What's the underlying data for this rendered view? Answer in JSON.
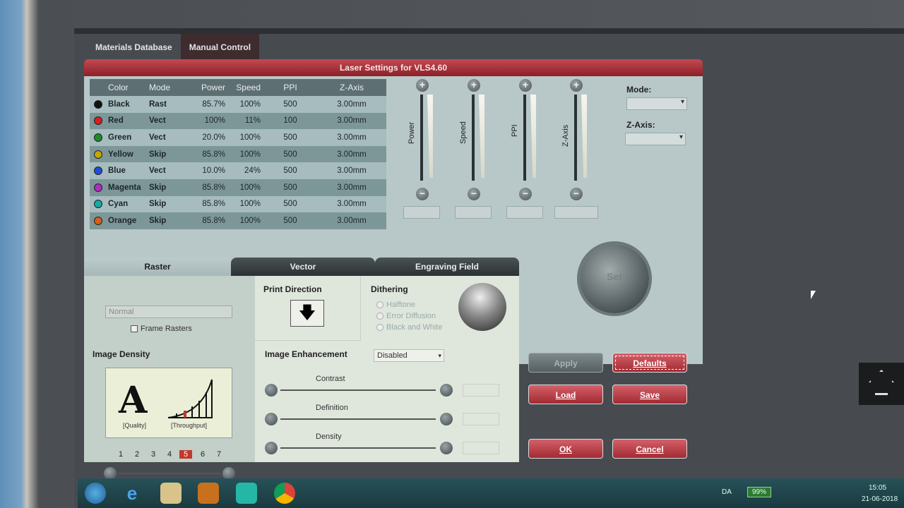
{
  "nav": {
    "tabs": [
      {
        "label": "Materials Database"
      },
      {
        "label": "Manual Control"
      }
    ]
  },
  "window": {
    "title": "Laser Settings for VLS4.60"
  },
  "table": {
    "headers": {
      "color": "Color",
      "mode": "Mode",
      "power": "Power",
      "speed": "Speed",
      "ppi": "PPI",
      "z": "Z-Axis"
    },
    "rows": [
      {
        "color": "Black",
        "swatch": "#111111",
        "mode": "Rast",
        "power": "85.7%",
        "speed": "100%",
        "ppi": "500",
        "z": "3.00mm"
      },
      {
        "color": "Red",
        "swatch": "#d62020",
        "mode": "Vect",
        "power": "100%",
        "speed": "11%",
        "ppi": "100",
        "z": "3.00mm"
      },
      {
        "color": "Green",
        "swatch": "#1f8a2a",
        "mode": "Vect",
        "power": "20.0%",
        "speed": "100%",
        "ppi": "500",
        "z": "3.00mm"
      },
      {
        "color": "Yellow",
        "swatch": "#c8a400",
        "mode": "Skip",
        "power": "85.8%",
        "speed": "100%",
        "ppi": "500",
        "z": "3.00mm"
      },
      {
        "color": "Blue",
        "swatch": "#1f4fd6",
        "mode": "Vect",
        "power": "10.0%",
        "speed": "24%",
        "ppi": "500",
        "z": "3.00mm"
      },
      {
        "color": "Magenta",
        "swatch": "#b02cc4",
        "mode": "Skip",
        "power": "85.8%",
        "speed": "100%",
        "ppi": "500",
        "z": "3.00mm"
      },
      {
        "color": "Cyan",
        "swatch": "#1aa7a7",
        "mode": "Skip",
        "power": "85.8%",
        "speed": "100%",
        "ppi": "500",
        "z": "3.00mm"
      },
      {
        "color": "Orange",
        "swatch": "#d4601a",
        "mode": "Skip",
        "power": "85.8%",
        "speed": "100%",
        "ppi": "500",
        "z": "3.00mm"
      }
    ]
  },
  "sliders": {
    "power": "Power",
    "speed": "Speed",
    "ppi": "PPI",
    "z": "Z-Axis",
    "plus": "+",
    "minus": "−"
  },
  "side": {
    "mode_label": "Mode:",
    "z_label": "Z-Axis:",
    "set_label": "Set"
  },
  "tabs": [
    {
      "label": "Raster"
    },
    {
      "label": "Vector"
    },
    {
      "label": "Engraving Field"
    }
  ],
  "raster": {
    "mode_select": "Normal",
    "frame_rasters": "Frame Rasters",
    "image_density": "Image Density",
    "quality": "[Quality]",
    "throughput": "[Throughput]",
    "density_numbers": [
      "1",
      "2",
      "3",
      "4",
      "5",
      "6",
      "7"
    ],
    "density_selected": "5",
    "print_direction": "Print Direction",
    "dithering": "Dithering",
    "dither_options": [
      "Halftone",
      "Error Diffusion",
      "Black and White"
    ],
    "image_enhancement": "Image Enhancement",
    "enhancement_value": "Disabled",
    "contrast": "Contrast",
    "definition": "Definition",
    "density": "Density"
  },
  "buttons": {
    "apply": "Apply",
    "defaults": "Defaults",
    "load": "Load",
    "save": "Save",
    "ok": "OK",
    "cancel": "Cancel"
  },
  "taskbar": {
    "lang": "DA",
    "battery": "99%",
    "time": "15:05",
    "date": "21-06-2018"
  }
}
